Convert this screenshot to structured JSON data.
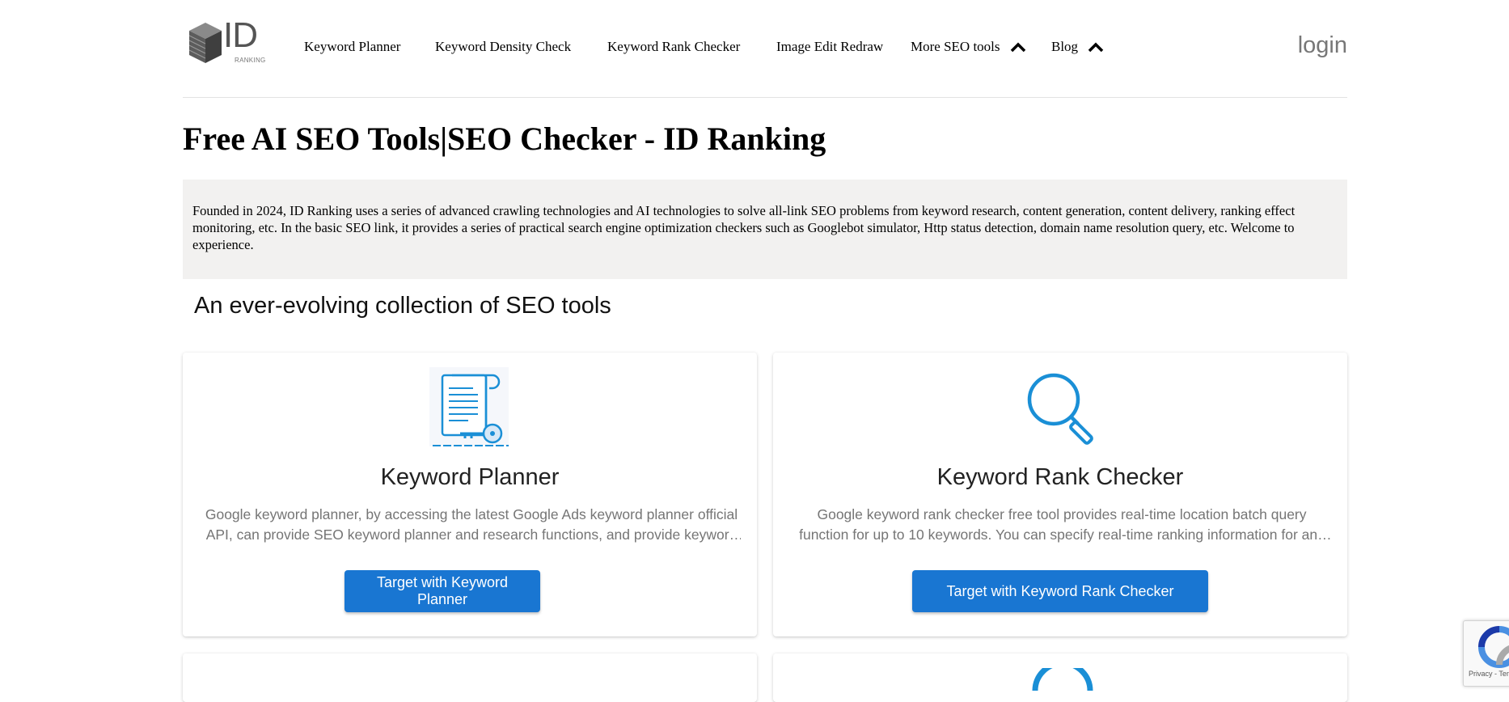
{
  "header": {
    "logo_text": "ID",
    "logo_subtext": "RANKING",
    "nav": [
      {
        "label": "Keyword Planner"
      },
      {
        "label": "Keyword Density Check"
      },
      {
        "label": "Keyword Rank Checker"
      },
      {
        "label": "Image Edit Redraw"
      },
      {
        "label": "More SEO tools",
        "icon": "chevron-up-icon"
      },
      {
        "label": "Blog",
        "icon": "chevron-up-icon"
      }
    ],
    "login": "login"
  },
  "page": {
    "title": "Free AI SEO Tools|SEO Checker - ID Ranking",
    "intro": "Founded in 2024, ID Ranking uses a series of advanced crawling technologies and AI technologies to solve all-link SEO problems from keyword research, content generation, content delivery, ranking effect monitoring, etc. In the basic SEO link, it provides a series of practical search engine optimization checkers such as Googlebot simulator, Http status detection, domain name resolution query, etc. Welcome to experience.",
    "subheading": "An ever-evolving collection of SEO tools"
  },
  "cards": [
    {
      "icon": "document-key-icon",
      "title": "Keyword Planner",
      "description": "Google keyword planner, by accessing the latest Google Ads keyword planner official API, can provide SEO keyword planner and research functions, and provide keyword search volume, competition and trend data.",
      "button": "Target with Keyword Planner"
    },
    {
      "icon": "magnifier-icon",
      "title": "Keyword Rank Checker",
      "description": "Google keyword rank checker free tool provides real-time location batch query function for up to 10 keywords. You can specify real-time ranking information for any location.",
      "button": "Target with Keyword Rank Checker"
    }
  ],
  "recaptcha": {
    "text": "Privacy - Terms"
  },
  "colors": {
    "primary_button": "#1976d2",
    "intro_bg": "#f2f1f0",
    "icon_blue": "#1a8fd6"
  }
}
